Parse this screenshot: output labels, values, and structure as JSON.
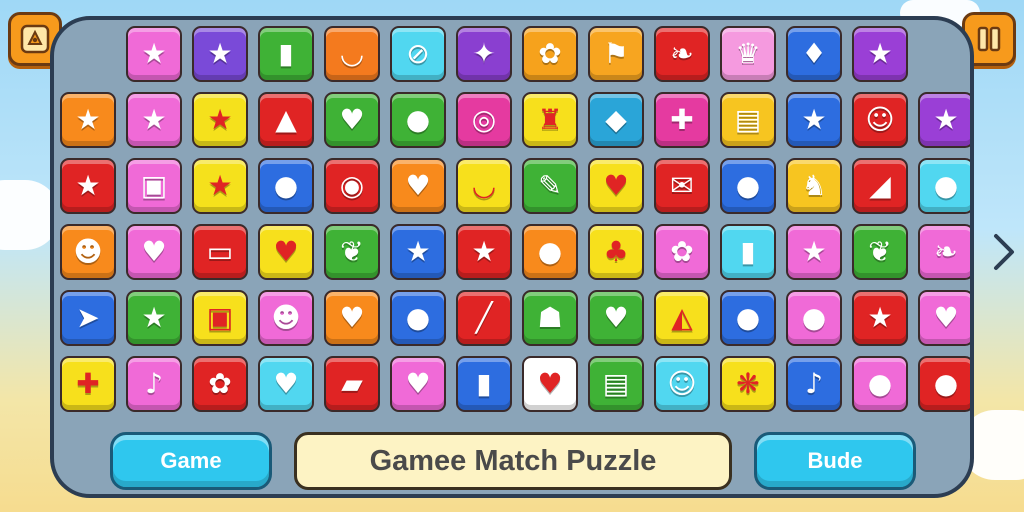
{
  "game": {
    "title": "Gamee Match Puzzle"
  },
  "buttons": {
    "left_label": "Game",
    "right_label": "Bude"
  },
  "corner_icons": {
    "left": "emblem-icon",
    "right": "pause-icon"
  },
  "nav": {
    "next": "arrow-right-icon"
  },
  "tiles": [
    [
      [
        "#f06ad7",
        "★"
      ],
      [
        "#7a4ad8",
        "★"
      ],
      [
        "#3fb236",
        "▮"
      ],
      [
        "#f47a1e",
        "◡"
      ],
      [
        "#51d7f0",
        "⊘"
      ],
      [
        "#8a3fd0",
        "✦"
      ],
      [
        "#f6a21c",
        "✿"
      ],
      [
        "#f7a520",
        "⚑"
      ],
      [
        "#e02424",
        "❧"
      ],
      [
        "#f59adf",
        "♛"
      ],
      [
        "#2d6de0",
        "♦"
      ],
      [
        "#9a3fd6",
        "★"
      ]
    ],
    [
      [
        "#f88a1c",
        "★"
      ],
      [
        "#f06ad7",
        "★"
      ],
      [
        "#f5e11c",
        "★"
      ],
      [
        "#e02424",
        "▲"
      ],
      [
        "#3fb236",
        "♥"
      ],
      [
        "#3fb236",
        "●"
      ],
      [
        "#e53aa0",
        "◎"
      ],
      [
        "#f7e01c",
        "♜"
      ],
      [
        "#2aa5d8",
        "◆"
      ],
      [
        "#e53aa0",
        "✚"
      ],
      [
        "#f7c520",
        "▤"
      ],
      [
        "#2d6de0",
        "★"
      ],
      [
        "#e02424",
        "☺"
      ],
      [
        "#9a3fd6",
        "★"
      ]
    ],
    [
      [
        "#e02424",
        "★"
      ],
      [
        "#f06ad7",
        "▣"
      ],
      [
        "#f5e11c",
        "★"
      ],
      [
        "#2d6de0",
        "●"
      ],
      [
        "#e02424",
        "◉"
      ],
      [
        "#f88a1c",
        "♥"
      ],
      [
        "#f7e01c",
        "◡"
      ],
      [
        "#3fb236",
        "✎"
      ],
      [
        "#f7e01c",
        "♥"
      ],
      [
        "#e02424",
        "✉"
      ],
      [
        "#2d6de0",
        "●"
      ],
      [
        "#f7c520",
        "♞"
      ],
      [
        "#e02424",
        "◢"
      ],
      [
        "#51d7f0",
        "●"
      ]
    ],
    [
      [
        "#f88a1c",
        "☻"
      ],
      [
        "#f06ad7",
        "♥"
      ],
      [
        "#e02424",
        "▭"
      ],
      [
        "#f7e01c",
        "♥"
      ],
      [
        "#3fb236",
        "❦"
      ],
      [
        "#2d6de0",
        "★"
      ],
      [
        "#e02424",
        "★"
      ],
      [
        "#f88a1c",
        "●"
      ],
      [
        "#f7e01c",
        "♣"
      ],
      [
        "#f06ad7",
        "✿"
      ],
      [
        "#51d7f0",
        "▮"
      ],
      [
        "#f06ad7",
        "★"
      ],
      [
        "#3fb236",
        "❦"
      ],
      [
        "#f06ad7",
        "❧"
      ]
    ],
    [
      [
        "#2d6de0",
        "➤"
      ],
      [
        "#3fb236",
        "★"
      ],
      [
        "#f7e01c",
        "▣"
      ],
      [
        "#f06ad7",
        "☻"
      ],
      [
        "#f88a1c",
        "♥"
      ],
      [
        "#2d6de0",
        "●"
      ],
      [
        "#e02424",
        "╱"
      ],
      [
        "#3fb236",
        "☗"
      ],
      [
        "#3fb236",
        "♥"
      ],
      [
        "#f7e01c",
        "◭"
      ],
      [
        "#2d6de0",
        "●"
      ],
      [
        "#f06ad7",
        "●"
      ],
      [
        "#e02424",
        "★"
      ],
      [
        "#f06ad7",
        "♥"
      ]
    ],
    [
      [
        "#f7e01c",
        "✚"
      ],
      [
        "#f06ad7",
        "♪"
      ],
      [
        "#e02424",
        "✿"
      ],
      [
        "#51d7f0",
        "♥"
      ],
      [
        "#e02424",
        "▰"
      ],
      [
        "#f06ad7",
        "♥"
      ],
      [
        "#2d6de0",
        "▮"
      ],
      [
        "#ffffff",
        "♥"
      ],
      [
        "#3fb236",
        "▤"
      ],
      [
        "#51d7f0",
        "☺"
      ],
      [
        "#f7e01c",
        "❋"
      ],
      [
        "#2d6de0",
        "♪"
      ],
      [
        "#f06ad7",
        "●"
      ],
      [
        "#e02424",
        "●"
      ]
    ]
  ]
}
